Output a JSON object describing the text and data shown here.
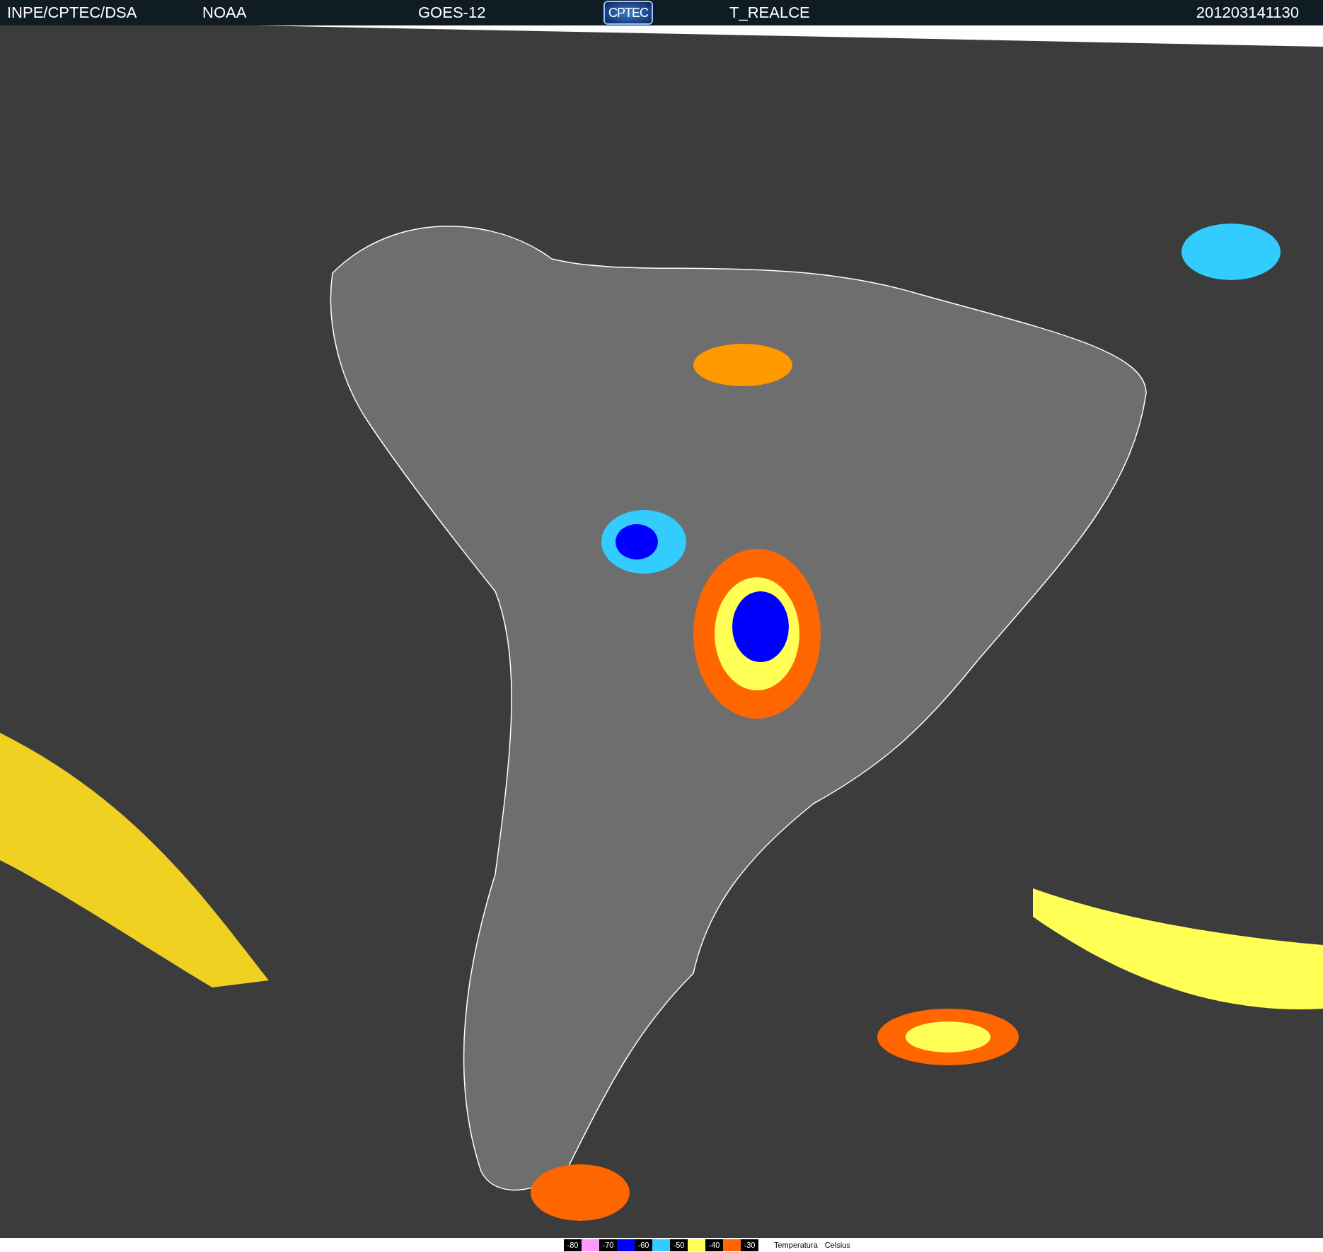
{
  "header": [
    {
      "kind": "text",
      "text": "INPE/CPTEC/DSA"
    },
    {
      "kind": "text",
      "text": "NOAA"
    },
    {
      "kind": "text",
      "text": "GOES-12"
    },
    {
      "kind": "logo",
      "text": "CPTEC"
    },
    {
      "kind": "text",
      "text": "T_REALCE"
    },
    {
      "kind": "text",
      "text": "201203141130"
    }
  ],
  "legend": {
    "entries": [
      {
        "label": "-80",
        "color": "#ff99ff"
      },
      {
        "label": "-70",
        "color": "#0000ff"
      },
      {
        "label": "-60",
        "color": "#33ccff"
      },
      {
        "label": "-50",
        "color": "#ffff55"
      },
      {
        "label": "-40",
        "color": "#ff6600"
      },
      {
        "label": "-30"
      }
    ],
    "caption": [
      "Temperatura",
      "Celsius"
    ]
  }
}
